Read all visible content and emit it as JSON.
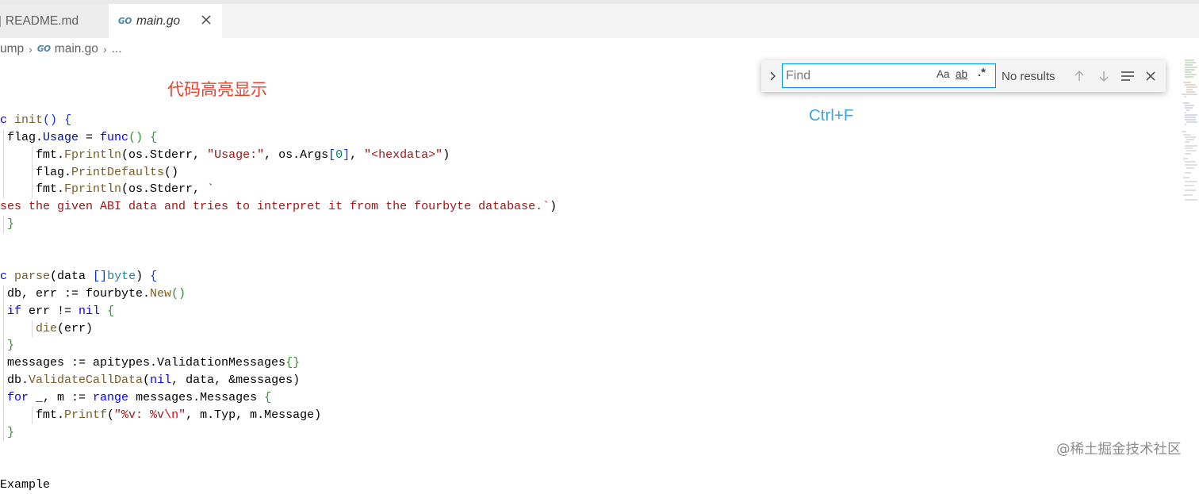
{
  "tabs": [
    {
      "label": "README.md",
      "active": false
    },
    {
      "label": "main.go",
      "active": true
    }
  ],
  "breadcrumb": {
    "parent": "ump",
    "file": "main.go",
    "more": "..."
  },
  "go_icon_text": "GO",
  "annotations": {
    "highlight": "代码高亮显示",
    "shortcut": "Ctrl+F"
  },
  "find": {
    "placeholder": "Find",
    "status": "No results",
    "opt_case": "Aa",
    "opt_word": "ab",
    "opt_regex": ".*"
  },
  "watermark": "@稀土掘金技术社区",
  "code": [
    {
      "indent": 0,
      "tokens": [
        [
          "pl",
          ""
        ]
      ]
    },
    {
      "indent": 0,
      "tokens": [
        [
          "kw",
          "c "
        ],
        [
          "fn",
          "init"
        ],
        [
          "br1",
          "()"
        ],
        [
          "pl",
          " "
        ],
        [
          "br1",
          "{"
        ]
      ]
    },
    {
      "indent": 1,
      "tokens": [
        [
          "pl",
          " flag."
        ],
        [
          "var",
          "Usage"
        ],
        [
          "pl",
          " = "
        ],
        [
          "kw",
          "func"
        ],
        [
          "br2",
          "()"
        ],
        [
          "pl",
          " "
        ],
        [
          "br2",
          "{"
        ]
      ]
    },
    {
      "indent": 2,
      "tokens": [
        [
          "pl",
          "     fmt."
        ],
        [
          "fn",
          "Fprintln"
        ],
        [
          "pl",
          "(os.Stderr, "
        ],
        [
          "str",
          "\"Usage:\""
        ],
        [
          "pl",
          ", os.Args"
        ],
        [
          "br1",
          "["
        ],
        [
          "num",
          "0"
        ],
        [
          "br1",
          "]"
        ],
        [
          "pl",
          ", "
        ],
        [
          "str",
          "\"<hexdata>\""
        ],
        [
          "pl",
          ")"
        ]
      ]
    },
    {
      "indent": 2,
      "tokens": [
        [
          "pl",
          "     flag."
        ],
        [
          "fn",
          "PrintDefaults"
        ],
        [
          "pl",
          "()"
        ]
      ]
    },
    {
      "indent": 2,
      "tokens": [
        [
          "pl",
          "     fmt."
        ],
        [
          "fn",
          "Fprintln"
        ],
        [
          "pl",
          "(os.Stderr, "
        ],
        [
          "str",
          "`"
        ]
      ]
    },
    {
      "indent": 0,
      "tokens": [
        [
          "str",
          "ses the given ABI data and tries to interpret it from the fourbyte database.`"
        ],
        [
          "pl",
          ")"
        ]
      ]
    },
    {
      "indent": 1,
      "tokens": [
        [
          "pl",
          " "
        ],
        [
          "br2",
          "}"
        ]
      ]
    },
    {
      "indent": 0,
      "tokens": [
        [
          "pl",
          ""
        ]
      ]
    },
    {
      "indent": 0,
      "tokens": [
        [
          "pl",
          ""
        ]
      ]
    },
    {
      "indent": 0,
      "tokens": [
        [
          "kw",
          "c "
        ],
        [
          "fn",
          "parse"
        ],
        [
          "pl",
          "(data "
        ],
        [
          "br1",
          "[]"
        ],
        [
          "typ",
          "byte"
        ],
        [
          "pl",
          ") "
        ],
        [
          "br1",
          "{"
        ]
      ]
    },
    {
      "indent": 1,
      "tokens": [
        [
          "pl",
          " db, err := fourbyte."
        ],
        [
          "fn",
          "New"
        ],
        [
          "br2",
          "()"
        ]
      ]
    },
    {
      "indent": 1,
      "tokens": [
        [
          "pl",
          " "
        ],
        [
          "kw",
          "if"
        ],
        [
          "pl",
          " err != "
        ],
        [
          "kw",
          "nil"
        ],
        [
          "pl",
          " "
        ],
        [
          "br2",
          "{"
        ]
      ]
    },
    {
      "indent": 2,
      "tokens": [
        [
          "pl",
          "     "
        ],
        [
          "fn",
          "die"
        ],
        [
          "pl",
          "(err)"
        ]
      ]
    },
    {
      "indent": 1,
      "tokens": [
        [
          "pl",
          " "
        ],
        [
          "br2",
          "}"
        ]
      ]
    },
    {
      "indent": 1,
      "tokens": [
        [
          "pl",
          " messages := apitypes.ValidationMessages"
        ],
        [
          "br2",
          "{}"
        ]
      ]
    },
    {
      "indent": 1,
      "tokens": [
        [
          "pl",
          " db."
        ],
        [
          "fn",
          "ValidateCallData"
        ],
        [
          "pl",
          "("
        ],
        [
          "kw",
          "nil"
        ],
        [
          "pl",
          ", data, &messages)"
        ]
      ]
    },
    {
      "indent": 1,
      "tokens": [
        [
          "pl",
          " "
        ],
        [
          "kw",
          "for"
        ],
        [
          "pl",
          " _, m := "
        ],
        [
          "kw",
          "range"
        ],
        [
          "pl",
          " messages.Messages "
        ],
        [
          "br2",
          "{"
        ]
      ]
    },
    {
      "indent": 2,
      "tokens": [
        [
          "pl",
          "     fmt."
        ],
        [
          "fn",
          "Printf"
        ],
        [
          "pl",
          "("
        ],
        [
          "str",
          "\"%v: %v"
        ],
        [
          "esc",
          "\\n"
        ],
        [
          "str",
          "\""
        ],
        [
          "pl",
          ", m.Typ, m.Message)"
        ]
      ]
    },
    {
      "indent": 1,
      "tokens": [
        [
          "pl",
          " "
        ],
        [
          "br2",
          "}"
        ]
      ]
    },
    {
      "indent": 0,
      "tokens": [
        [
          "pl",
          ""
        ]
      ]
    },
    {
      "indent": 0,
      "tokens": [
        [
          "pl",
          ""
        ]
      ]
    },
    {
      "indent": 0,
      "tokens": [
        [
          "pl",
          "Example"
        ]
      ]
    }
  ]
}
